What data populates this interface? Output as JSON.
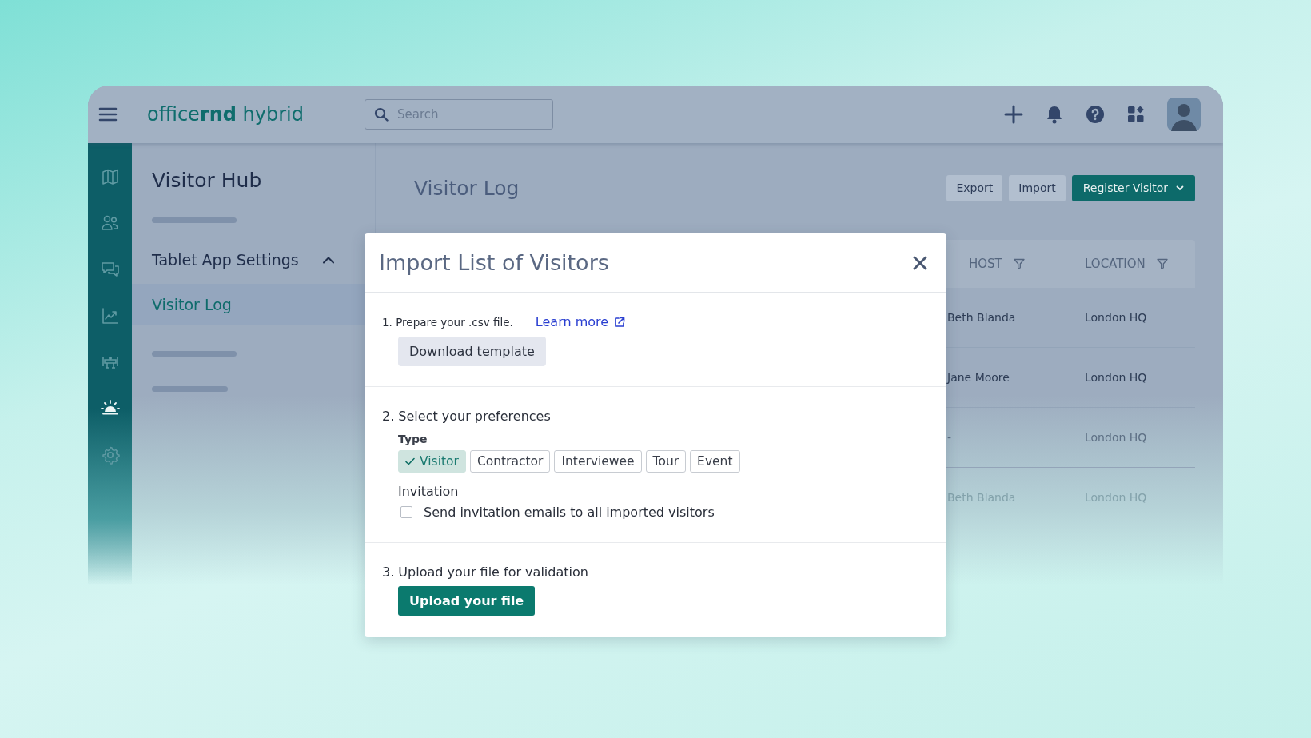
{
  "topbar": {
    "logo": "office**rnd** hybrid",
    "search": {
      "placeholder": "Search"
    }
  },
  "rail": [
    {
      "selected": false
    },
    {
      "selected": false
    },
    {
      "selected": false
    },
    {
      "selected": false
    },
    {
      "selected": false
    },
    {
      "selected": true
    },
    {
      "selected": false
    }
  ],
  "nav": {
    "title": "Visitor Hub",
    "group": {
      "label": "Tablet App Settings",
      "expanded": true,
      "children": [
        {
          "label": "Visitor Log",
          "selected": true
        }
      ]
    }
  },
  "main": {
    "title": "Visitor Log",
    "buttons": [
      "Export",
      "Import"
    ],
    "primary": "Register Visitor"
  },
  "table": {
    "columns": [
      {
        "label": "HOST"
      },
      {
        "label": "LOCATION"
      }
    ],
    "rows": [
      {
        "host": "Beth Blanda",
        "location": "London HQ"
      },
      {
        "host": "Jane Moore",
        "location": "London HQ"
      },
      {
        "host": "-",
        "location": "London HQ"
      },
      {
        "host": "Beth Blanda",
        "location": "London HQ"
      }
    ]
  },
  "modal": {
    "title": "Import List of Visitors",
    "step1": {
      "label": "1. Prepare your .csv file.",
      "link": "Learn more",
      "button": "Download template"
    },
    "step2": {
      "heading": "2. Select your preferences",
      "type_label": "Type",
      "types": [
        {
          "label": "Visitor",
          "selected": true
        },
        {
          "label": "Contractor",
          "selected": false
        },
        {
          "label": "Interviewee",
          "selected": false
        },
        {
          "label": "Tour",
          "selected": false
        },
        {
          "label": "Event",
          "selected": false
        }
      ],
      "invitation_label": "Invitation",
      "invitation": {
        "label": "Send invitation emails to all imported visitors",
        "checked": false
      }
    },
    "step3": {
      "heading": "3. Upload your file for validation",
      "button": "Upload your file"
    }
  }
}
